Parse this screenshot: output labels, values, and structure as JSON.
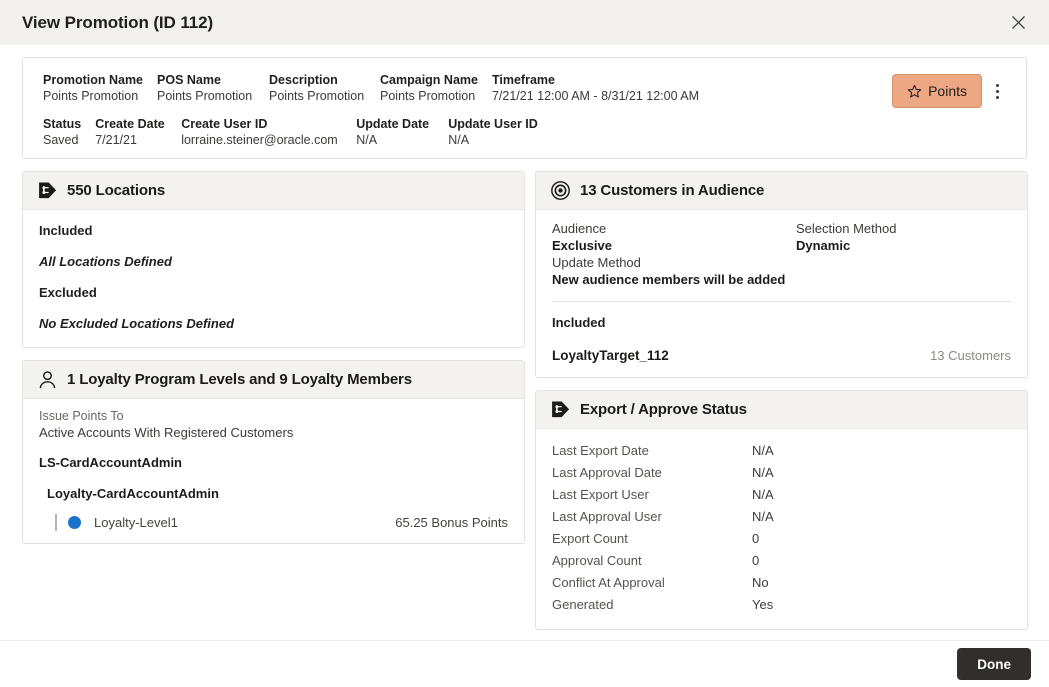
{
  "dialog": {
    "title": "View Promotion (ID 112)",
    "close_icon": "close-icon",
    "done_label": "Done"
  },
  "summary": {
    "row1": [
      {
        "label": "Promotion Name",
        "value": "Points Promotion"
      },
      {
        "label": "POS Name",
        "value": "Points Promotion"
      },
      {
        "label": "Description",
        "value": "Points Promotion"
      },
      {
        "label": "Campaign Name",
        "value": "Points Promotion"
      },
      {
        "label": "Timeframe",
        "value": "7/21/21 12:00 AM - 8/31/21 12:00 AM"
      }
    ],
    "row2": [
      {
        "label": "Status",
        "value": "Saved"
      },
      {
        "label": "Create Date",
        "value": "7/21/21"
      },
      {
        "label": "Create User ID",
        "value": "lorraine.steiner@oracle.com"
      },
      {
        "label": "Update Date",
        "value": "N/A"
      },
      {
        "label": "Update User ID",
        "value": "N/A"
      }
    ],
    "points_badge": {
      "label": "Points",
      "icon": "star-icon",
      "bg_color": "#EDA782"
    },
    "overflow_icon": "kebab-menu-icon"
  },
  "locations_panel": {
    "icon": "tag-icon",
    "title": "550 Locations",
    "included_label": "Included",
    "included_value": "All Locations Defined",
    "excluded_label": "Excluded",
    "excluded_value": "No Excluded Locations Defined"
  },
  "audience_panel": {
    "icon": "target-icon",
    "title": "13 Customers in Audience",
    "audience_label": "Audience",
    "audience_value": "Exclusive",
    "selection_method_label": "Selection Method",
    "selection_method_value": "Dynamic",
    "update_method_label": "Update Method",
    "update_method_value": "New audience members will be added",
    "included_label": "Included",
    "target_name": "LoyaltyTarget_112",
    "target_count": "13 Customers"
  },
  "loyalty_panel": {
    "icon": "person-icon",
    "title": "1 Loyalty Program Levels and 9 Loyalty Members",
    "issue_points_label": "Issue Points To",
    "issue_points_value": "Active Accounts With Registered Customers",
    "group": "LS-CardAccountAdmin",
    "subgroup": "Loyalty-CardAccountAdmin",
    "level": {
      "name": "Loyalty-Level1",
      "points": "65.25 Bonus Points",
      "dot_color": "#1A73C8"
    }
  },
  "export_panel": {
    "icon": "tag-icon",
    "title": "Export / Approve Status",
    "rows": [
      {
        "label": "Last Export Date",
        "value": "N/A"
      },
      {
        "label": "Last Approval Date",
        "value": "N/A"
      },
      {
        "label": "Last Export User",
        "value": "N/A"
      },
      {
        "label": "Last Approval User",
        "value": "N/A"
      },
      {
        "label": "Export Count",
        "value": "0"
      },
      {
        "label": "Approval Count",
        "value": "0"
      },
      {
        "label": "Conflict At Approval",
        "value": "No"
      },
      {
        "label": "Generated",
        "value": "Yes"
      }
    ]
  }
}
